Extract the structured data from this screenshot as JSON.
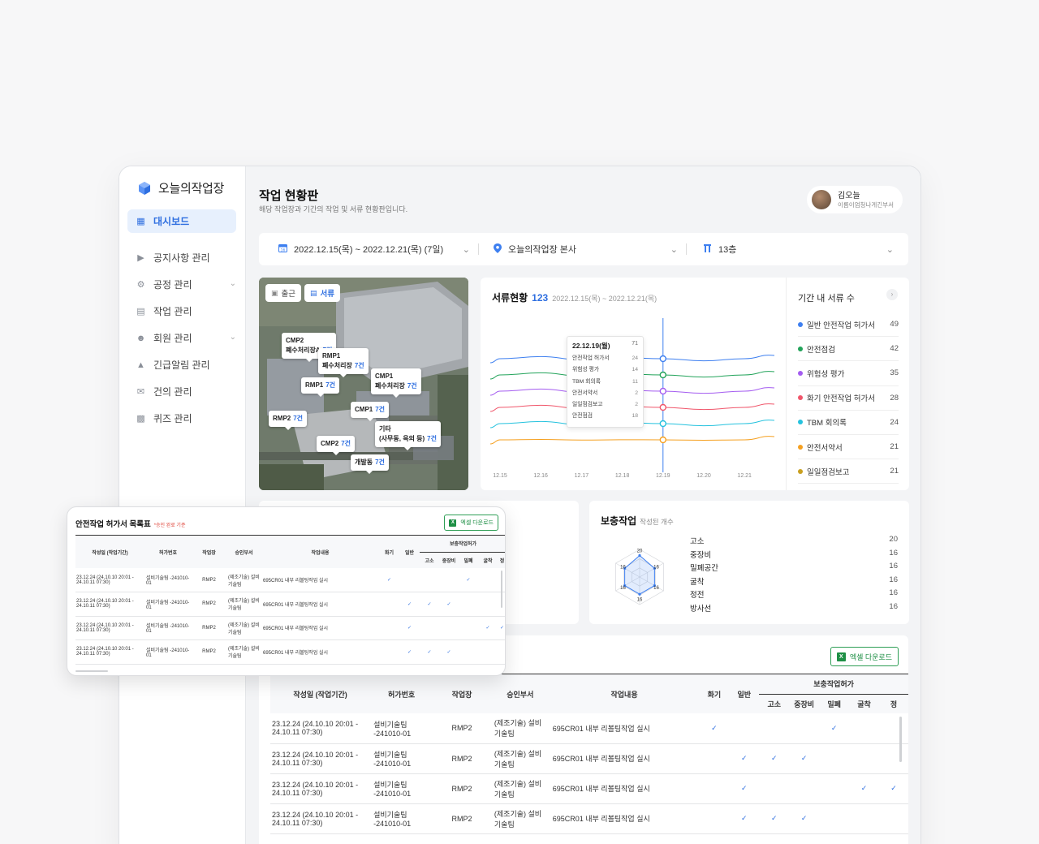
{
  "app": {
    "name": "오늘의작업장"
  },
  "sidebar": {
    "items": [
      {
        "label": "대시보드",
        "icon": "grid-icon",
        "active": true
      },
      {
        "label": "공지사항 관리",
        "icon": "megaphone-icon"
      },
      {
        "label": "공정 관리",
        "icon": "gear-icon",
        "expandable": true
      },
      {
        "label": "작업 관리",
        "icon": "list-icon"
      },
      {
        "label": "회원 관리",
        "icon": "user-icon",
        "expandable": true
      },
      {
        "label": "긴급알림 관리",
        "icon": "siren-icon"
      },
      {
        "label": "건의 관리",
        "icon": "mail-icon"
      },
      {
        "label": "퀴즈 관리",
        "icon": "puzzle-icon"
      }
    ]
  },
  "header": {
    "title": "작업 현황판",
    "subtitle": "해당 작업장과 기간의 작업 및 서류 현황판입니다.",
    "user": {
      "name": "김오늘",
      "dept": "이름이엄청나게긴부서"
    }
  },
  "filters": {
    "date_range": "2022.12.15(목) ~ 2022.12.21(목) (7일)",
    "site": "오늘의작업장 본사",
    "floor": "13층"
  },
  "map": {
    "buttons": [
      {
        "label": "출근"
      },
      {
        "label": "서류"
      }
    ],
    "pins": [
      {
        "name": "CMP2",
        "sub": "폐수처리장A",
        "count": "7건"
      },
      {
        "name": "RMP1",
        "sub": "폐수처리장",
        "count": "7건"
      },
      {
        "name": "RMP1",
        "count": "7건"
      },
      {
        "name": "CMP1",
        "sub": "폐수처리장",
        "count": "7건"
      },
      {
        "name": "CMP1",
        "count": "7건"
      },
      {
        "name": "RMP2",
        "count": "7건"
      },
      {
        "name": "기타",
        "sub": "(사무동, 옥외 등)",
        "count": "7건"
      },
      {
        "name": "CMP2",
        "count": "7건"
      },
      {
        "name": "개발동",
        "count": "7건"
      }
    ]
  },
  "docs": {
    "title": "서류현황",
    "total": "123",
    "range": "2022.12.15(목) ~ 2022.12.21(목)",
    "tooltip": {
      "date": "22.12.19(월)",
      "total": "71",
      "rows": [
        {
          "label": "안전작업 허가서",
          "value": "24"
        },
        {
          "label": "위험성 평가",
          "value": "14"
        },
        {
          "label": "TBM 회의록",
          "value": "11"
        },
        {
          "label": "안전서약서",
          "value": "2"
        },
        {
          "label": "일일점검보고",
          "value": "2"
        },
        {
          "label": "안전점검",
          "value": "18"
        }
      ]
    },
    "side_title": "기간 내 서류 수",
    "side_list": [
      {
        "label": "일반 안전작업 허가서",
        "value": "49",
        "color": "#3d7ff0"
      },
      {
        "label": "안전점검",
        "value": "42",
        "color": "#22a35a"
      },
      {
        "label": "위험성 평가",
        "value": "35",
        "color": "#a45cf0"
      },
      {
        "label": "화기 안전작업 허가서",
        "value": "28",
        "color": "#f0566b"
      },
      {
        "label": "TBM 회의록",
        "value": "24",
        "color": "#25c2de"
      },
      {
        "label": "안전서약서",
        "value": "21",
        "color": "#f5a020"
      },
      {
        "label": "일일점검보고",
        "value": "21",
        "color": "#c9a020"
      }
    ]
  },
  "chart_data": {
    "type": "line",
    "x": [
      "12.15",
      "12.16",
      "12.17",
      "12.18",
      "12.19",
      "12.20",
      "12.21"
    ],
    "highlight_x": "12.19",
    "series": [
      {
        "color": "#3d7ff0",
        "values": [
          24,
          26,
          23,
          25,
          24,
          22,
          24
        ]
      },
      {
        "color": "#22a35a",
        "values": [
          18,
          20,
          17,
          19,
          18,
          16,
          18
        ]
      },
      {
        "color": "#a45cf0",
        "values": [
          14,
          16,
          13,
          15,
          14,
          12,
          14
        ]
      },
      {
        "color": "#f0566b",
        "values": [
          11,
          13,
          10,
          12,
          11,
          9,
          11
        ]
      },
      {
        "color": "#25c2de",
        "values": [
          7,
          9,
          6,
          8,
          7,
          5,
          7
        ]
      },
      {
        "color": "#f5a020",
        "values": [
          2,
          2.3,
          1.8,
          2.1,
          2,
          1.7,
          2
        ]
      }
    ],
    "ylim": [
      0,
      30
    ],
    "grid": false
  },
  "supplement": {
    "title": "보충작업",
    "subtitle": "작성된 개수",
    "items": [
      {
        "label": "고소",
        "value": "20"
      },
      {
        "label": "중장비",
        "value": "16"
      },
      {
        "label": "밀폐공간",
        "value": "16"
      },
      {
        "label": "굴착",
        "value": "16"
      },
      {
        "label": "정전",
        "value": "16"
      },
      {
        "label": "방사선",
        "value": "16"
      }
    ],
    "radar_labels": [
      "20",
      "16",
      "16",
      "16",
      "16",
      "16"
    ]
  },
  "permit_table": {
    "title": "안전작업 허가서 목록표",
    "note": "*승인 완료 기준",
    "excel": "엑셀 다운로드",
    "group_header": "보충작업허가",
    "columns": [
      "작성일 (작업기간)",
      "허가번호",
      "작업장",
      "승인부서",
      "작업내용",
      "화기",
      "일반",
      "고소",
      "중장비",
      "밀폐",
      "굴착",
      "정"
    ],
    "rows": [
      {
        "date": "23.12.24 (24.10.10 20:01 - 24.10.11 07:30)",
        "permit": "설비기술팀 -241010-01",
        "site": "RMP2",
        "dept": "(제조기술) 설비기술팀",
        "content": "695CR01 내부 리볼팅작업 실시",
        "checks": [
          1,
          0,
          0,
          0,
          1,
          0,
          0
        ]
      },
      {
        "date": "23.12.24 (24.10.10 20:01 - 24.10.11 07:30)",
        "permit": "설비기술팀 -241010-01",
        "site": "RMP2",
        "dept": "(제조기술) 설비기술팀",
        "content": "695CR01 내부 리볼팅작업 실시",
        "checks": [
          0,
          1,
          1,
          1,
          0,
          0,
          0
        ]
      },
      {
        "date": "23.12.24 (24.10.10 20:01 - 24.10.11 07:30)",
        "permit": "설비기술팀 -241010-01",
        "site": "RMP2",
        "dept": "(제조기술) 설비기술팀",
        "content": "695CR01 내부 리볼팅작업 실시",
        "checks": [
          0,
          1,
          0,
          0,
          0,
          1,
          1
        ]
      },
      {
        "date": "23.12.24 (24.10.10 20:01 - 24.10.11 07:30)",
        "permit": "설비기술팀 -241010-01",
        "site": "RMP2",
        "dept": "(제조기술) 설비기술팀",
        "content": "695CR01 내부 리볼팅작업 실시",
        "checks": [
          0,
          1,
          1,
          1,
          0,
          0,
          0
        ]
      }
    ]
  }
}
